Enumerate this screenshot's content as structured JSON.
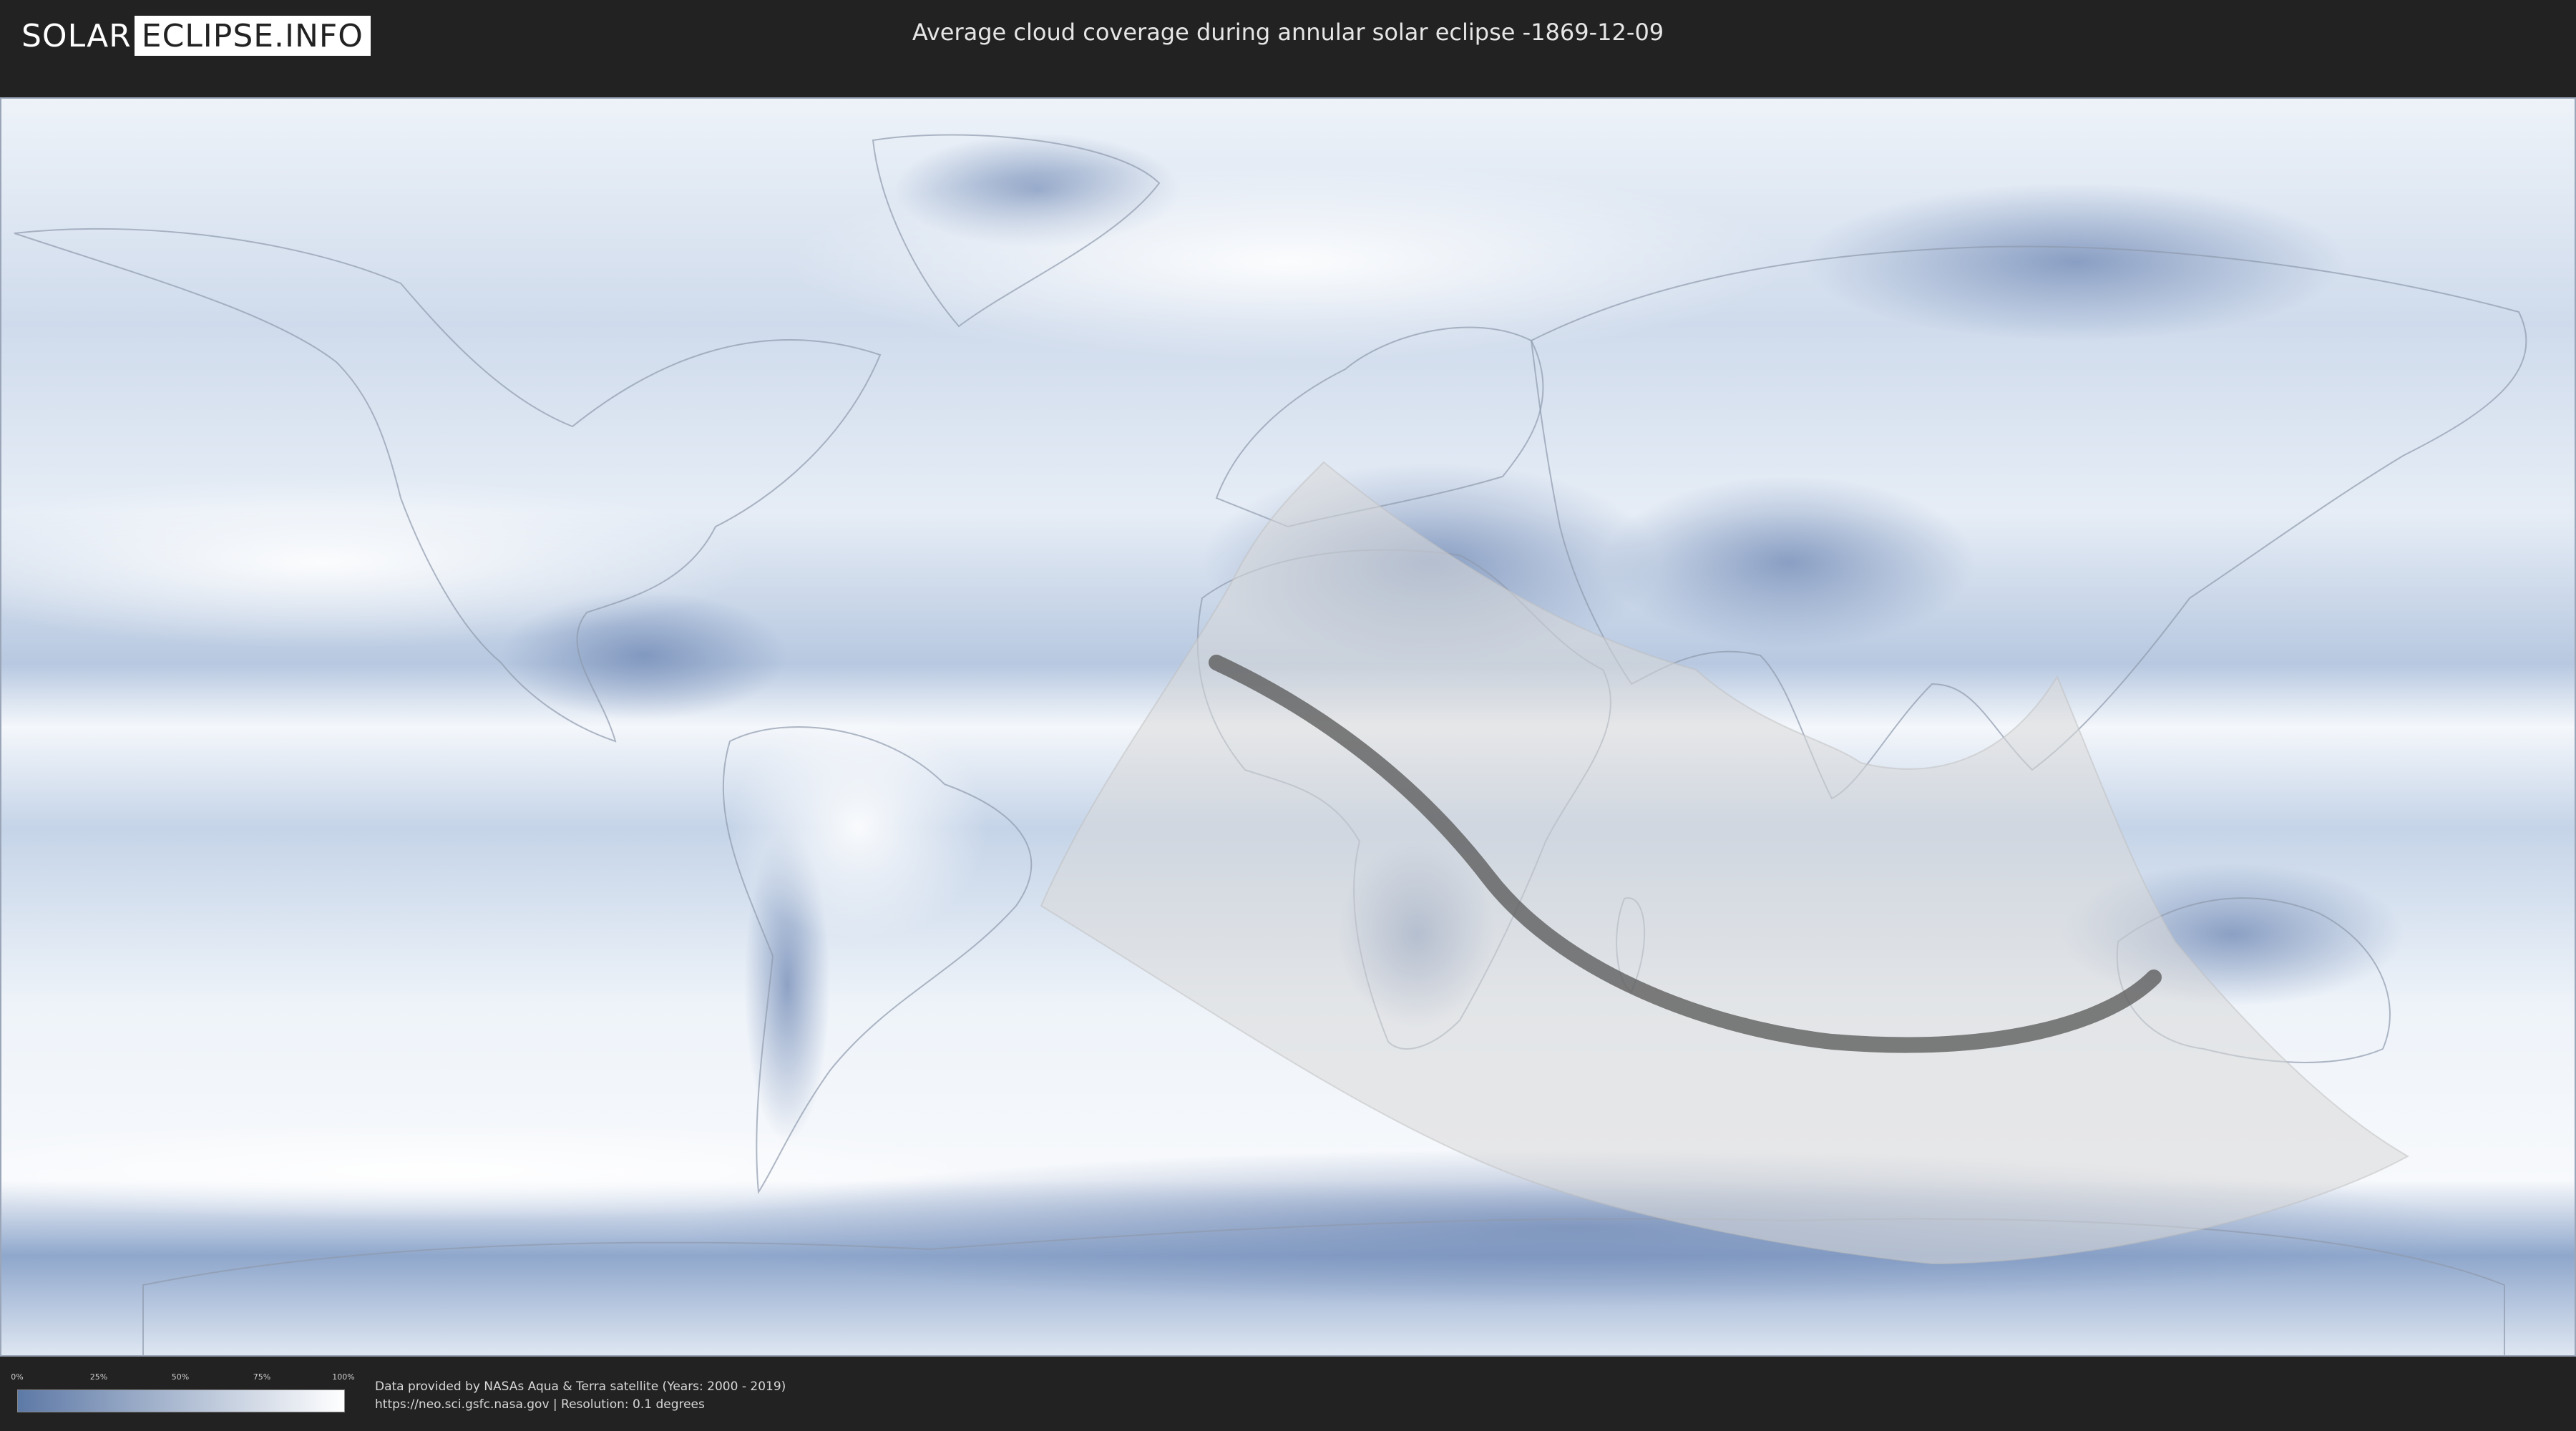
{
  "header": {
    "logo_left": "SOLAR",
    "logo_right": "ECLIPSE.INFO",
    "title": "Average cloud coverage during annular solar eclipse -1869-12-09"
  },
  "legend": {
    "ticks": [
      "0%",
      "25%",
      "50%",
      "75%",
      "100%"
    ],
    "color_low": "#5d79a6",
    "color_high": "#ffffff"
  },
  "footer": {
    "credit_line1": "Data provided by NASAs Aqua & Terra satellite (Years: 2000 - 2019)",
    "credit_line2": "https://neo.sci.gsfc.nasa.gov | Resolution: 0.1 degrees"
  },
  "colors": {
    "background": "#222222",
    "map_base": "#e9eff7",
    "cloud_blue": "#7f98c2",
    "penumbra": "#d9d9d9",
    "central_path": "#555555"
  }
}
